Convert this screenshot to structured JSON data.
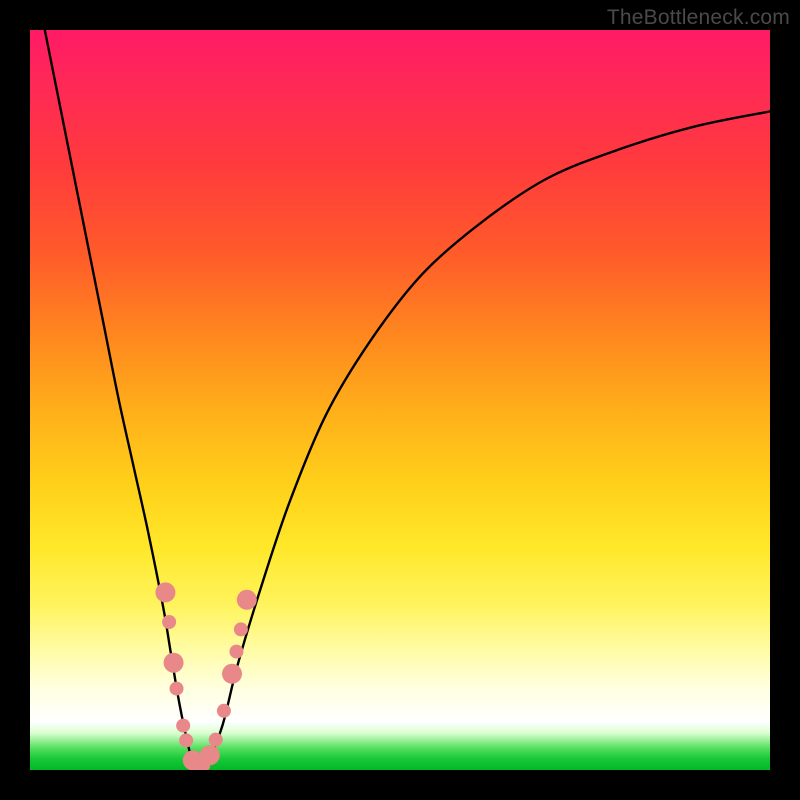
{
  "watermark": "TheBottleneck.com",
  "chart_data": {
    "type": "line",
    "title": "",
    "xlabel": "",
    "ylabel": "",
    "xlim": [
      0,
      100
    ],
    "ylim": [
      0,
      100
    ],
    "grid": false,
    "legend": false,
    "series": [
      {
        "name": "bottleneck-curve",
        "color": "#000000",
        "x": [
          2,
          4,
          6,
          8,
          10,
          12,
          14,
          16,
          18,
          19,
          20,
          21,
          22,
          23,
          24,
          26,
          28,
          31,
          35,
          40,
          46,
          53,
          61,
          70,
          80,
          90,
          100
        ],
        "y": [
          100,
          90,
          80,
          70,
          60,
          50,
          41,
          32,
          22,
          16,
          10,
          5,
          1,
          0,
          1,
          6,
          14,
          24,
          36,
          48,
          58,
          67,
          74,
          80,
          84,
          87,
          89
        ]
      }
    ],
    "markers": {
      "name": "highlighted-points",
      "color": "#e98888",
      "radius_small": 7,
      "radius_large": 10,
      "points": [
        {
          "x": 18.3,
          "y": 24,
          "r": "large"
        },
        {
          "x": 18.8,
          "y": 20,
          "r": "small"
        },
        {
          "x": 19.4,
          "y": 14.5,
          "r": "large"
        },
        {
          "x": 19.8,
          "y": 11,
          "r": "small"
        },
        {
          "x": 20.7,
          "y": 6,
          "r": "small"
        },
        {
          "x": 21.1,
          "y": 4,
          "r": "small"
        },
        {
          "x": 22.0,
          "y": 1.3,
          "r": "large"
        },
        {
          "x": 22.8,
          "y": 0.3,
          "r": "large"
        },
        {
          "x": 23.4,
          "y": 0.6,
          "r": "small"
        },
        {
          "x": 24.3,
          "y": 2.0,
          "r": "large"
        },
        {
          "x": 25.1,
          "y": 4.1,
          "r": "small"
        },
        {
          "x": 26.2,
          "y": 8,
          "r": "small"
        },
        {
          "x": 27.3,
          "y": 13,
          "r": "large"
        },
        {
          "x": 27.9,
          "y": 16,
          "r": "small"
        },
        {
          "x": 28.5,
          "y": 19,
          "r": "small"
        },
        {
          "x": 29.3,
          "y": 23,
          "r": "large"
        }
      ]
    },
    "background_gradient": {
      "top": "#ff1a66",
      "mid_upper": "#ff5a2a",
      "mid": "#ffd21a",
      "mid_lower": "#ffffe0",
      "bottom": "#00b828"
    }
  }
}
